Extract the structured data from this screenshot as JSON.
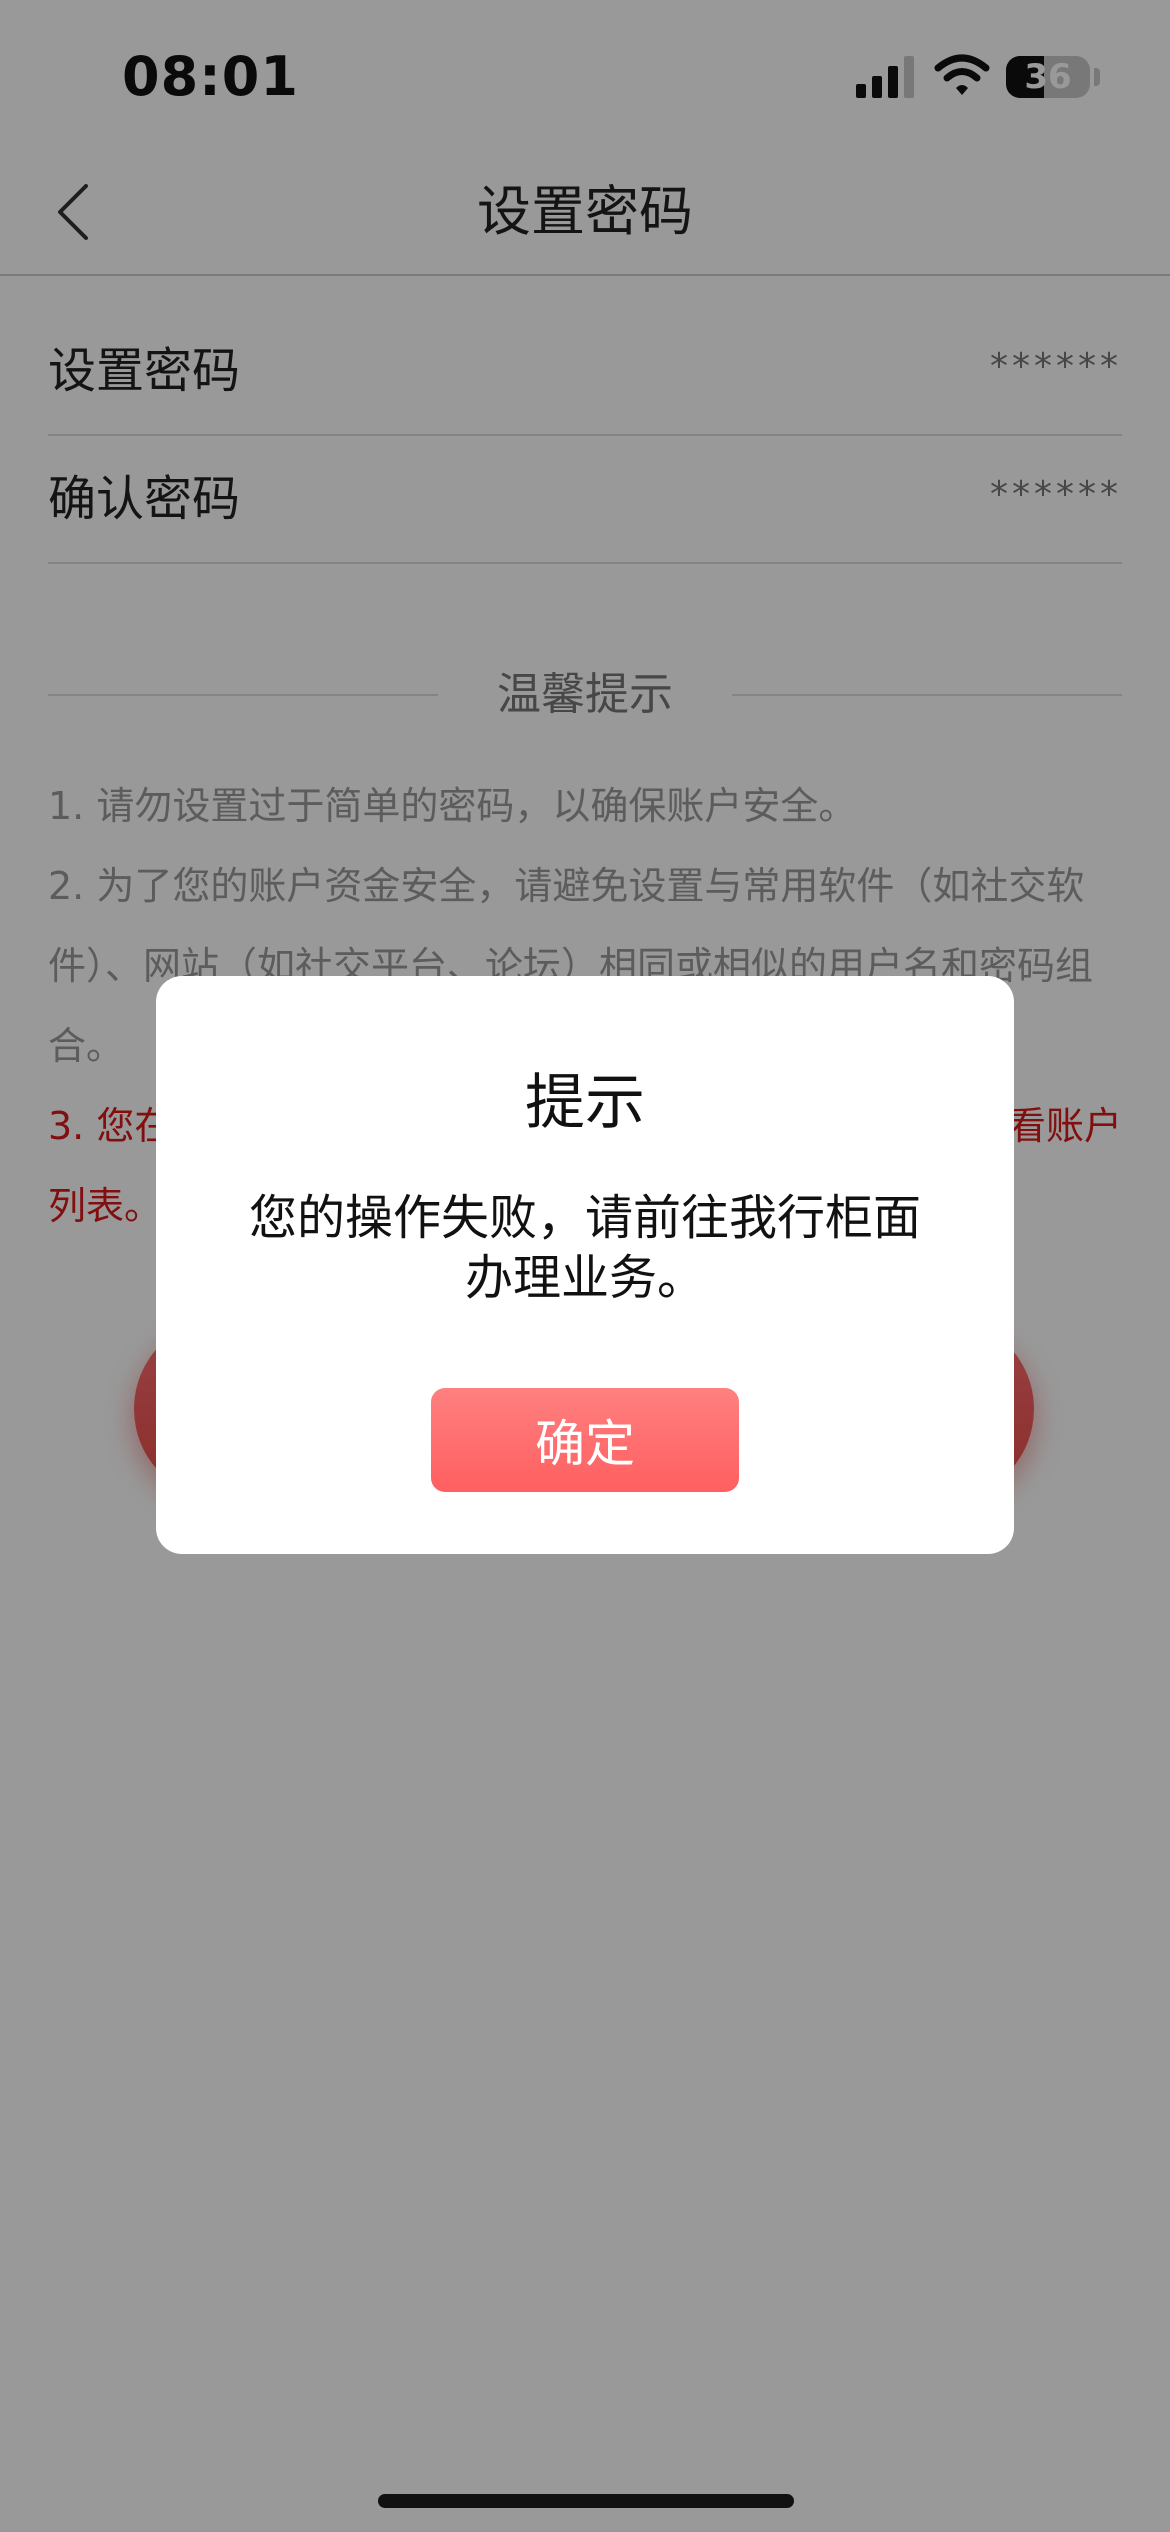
{
  "status_bar": {
    "time": "08:01",
    "battery": "36",
    "icons": [
      "cellular-signal-icon",
      "wifi-icon",
      "battery-icon"
    ]
  },
  "nav": {
    "title": "设置密码",
    "back_icon": "chevron-left-icon"
  },
  "form": {
    "password": {
      "label": "设置密码",
      "value": "******"
    },
    "confirm_password": {
      "label": "确认密码",
      "value": "******"
    }
  },
  "tips": {
    "title": "温馨提示",
    "items": [
      "1. 请勿设置过于简单的密码，以确保账户安全。",
      "2. 为了您的账户资金安全，请避免设置与常用软件（如社交软件）、网站（如社交平台、论坛）相同或相似的用户名和密码组合。"
    ],
    "red_lines": [
      "3. 您在",
      "看账户",
      "列表。"
    ]
  },
  "dialog": {
    "title": "提示",
    "message": "您的操作失败，请前往我行柜面办理业务。",
    "confirm_label": "确定"
  },
  "colors": {
    "accent": "#ff5f60",
    "warning_text": "#d71a1a",
    "overlay": "rgba(0,0,0,0.40)"
  }
}
